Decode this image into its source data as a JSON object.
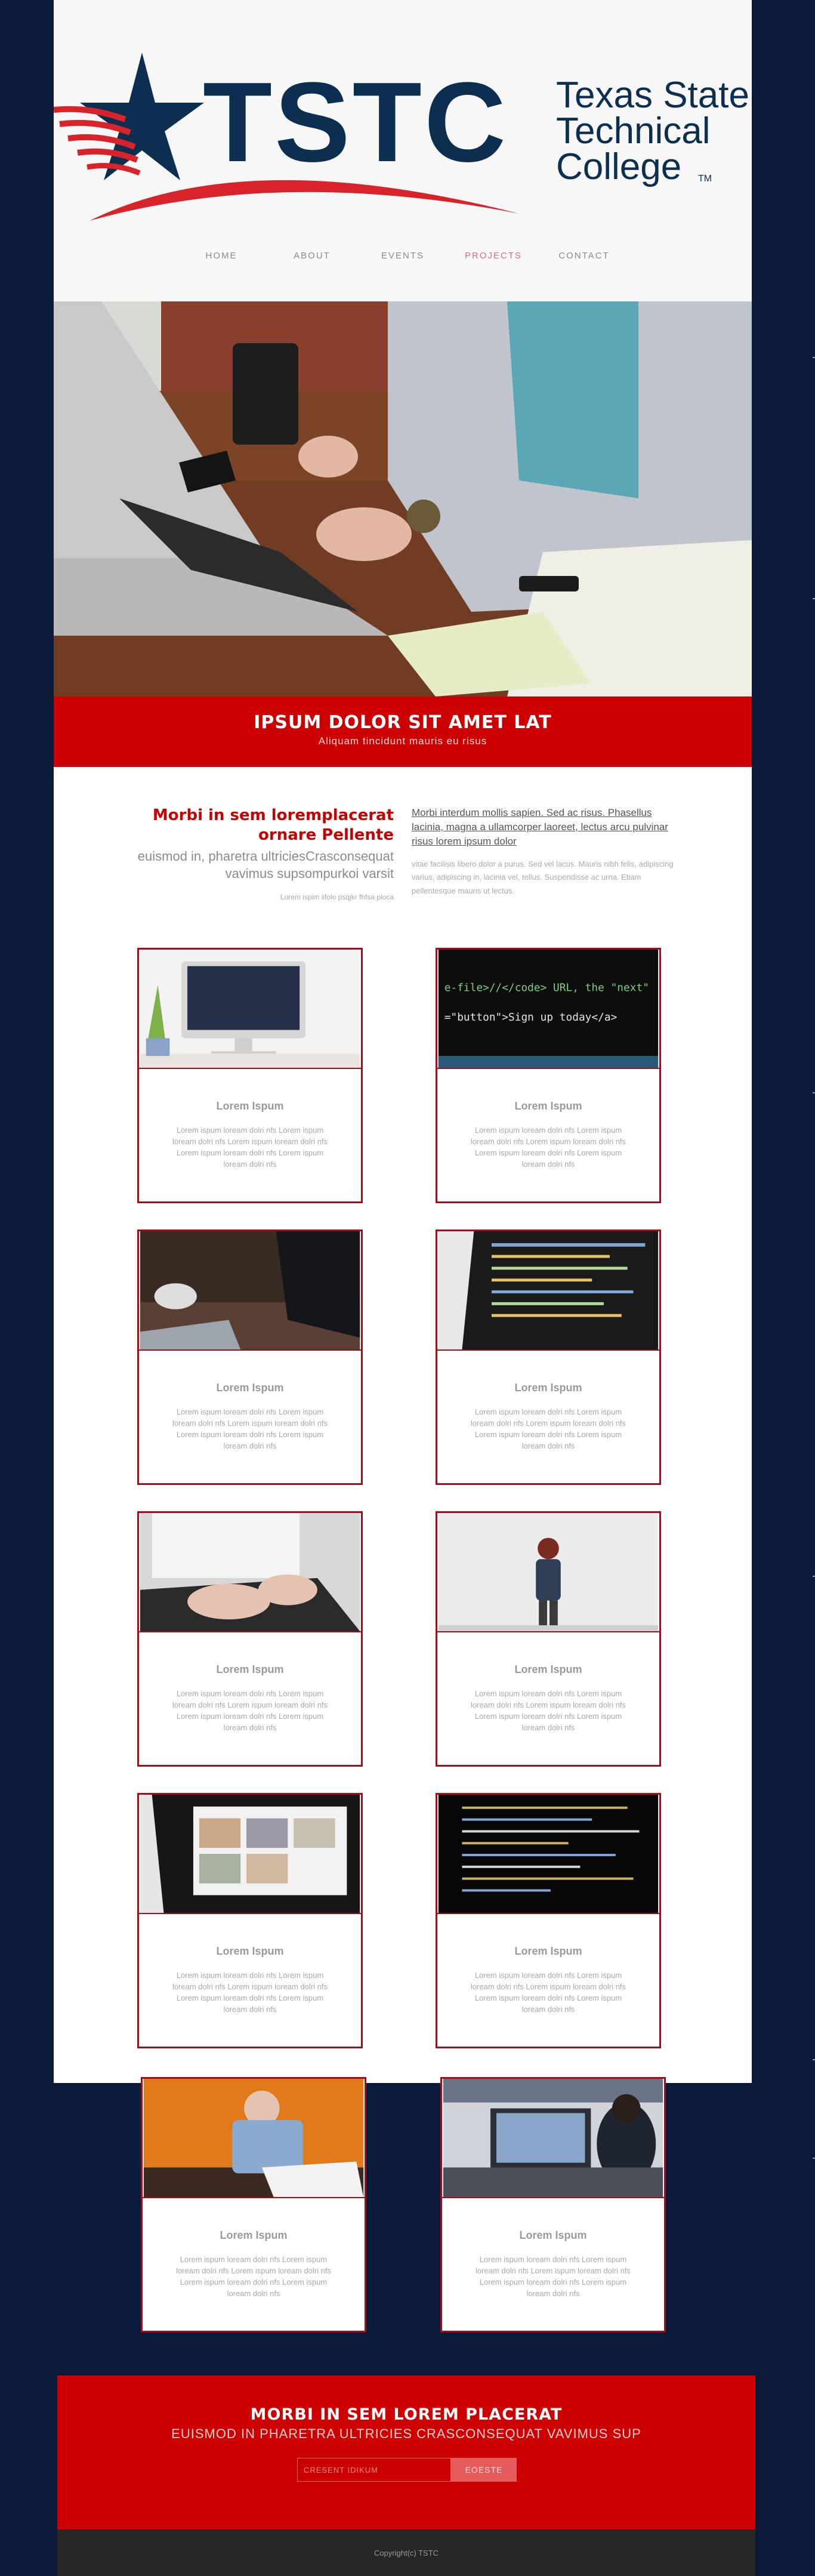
{
  "brand": {
    "abbr": "TSTC",
    "name_line1": "Texas State",
    "name_line2": "Technical",
    "name_line3": "College",
    "tm": "TM",
    "colors": {
      "navy": "#0c2f4f",
      "red": "#d8232a"
    }
  },
  "nav": {
    "items": [
      {
        "label": "HOME"
      },
      {
        "label": "ABOUT"
      },
      {
        "label": "EVENTS"
      },
      {
        "label": "PROJECTS",
        "active": true
      },
      {
        "label": "CONTACT"
      }
    ]
  },
  "banner": {
    "title": "IPSUM DOLOR SIT AMET LAT",
    "subtitle": "Aliquam tincidunt mauris eu risus"
  },
  "intro": {
    "heading": "Morbi in sem loremplacerat ornare Pellente",
    "subheading": "euismod in, pharetra ultriciesCrasconsequat vavimus supsompurkoi varsit",
    "small": "Lorem ispim lifolo psqjkr fhfsa ploca",
    "lead": "Morbi interdum mollis sapien. Sed ac risus. Phasellus lacinia, magna a ullamcorper laoreet, lectus arcu pulvinar risus lorem ipsum dolor",
    "body": "vitae facilisis libero dolor a purus. Sed vel lacus. Mauris nibh felis, adipiscing varius, adipiscing in, lacinia vel, tellus. Suspendisse ac urna. Etiam pellentesque mauris ut lectus."
  },
  "cards": [
    {
      "title": "Lorem Ispum",
      "text": "Lorem ispum loream dolri nfs Lorem ispum loream dolri nfs Lorem ispum loream dolri nfs Lorem ispum loream dolri nfs Lorem ispum loream dolri nfs"
    },
    {
      "title": "Lorem Ispum",
      "text": "Lorem ispum loream dolri nfs Lorem ispum loream dolri nfs Lorem ispum loream dolri nfs Lorem ispum loream dolri nfs Lorem ispum loream dolri nfs"
    },
    {
      "title": "Lorem Ispum",
      "text": "Lorem ispum loream dolri nfs Lorem ispum loream dolri nfs Lorem ispum loream dolri nfs Lorem ispum loream dolri nfs Lorem ispum loream dolri nfs"
    },
    {
      "title": "Lorem Ispum",
      "text": "Lorem ispum loream dolri nfs Lorem ispum loream dolri nfs Lorem ispum loream dolri nfs Lorem ispum loream dolri nfs Lorem ispum loream dolri nfs"
    },
    {
      "title": "Lorem Ispum",
      "text": "Lorem ispum loream dolri nfs Lorem ispum loream dolri nfs Lorem ispum loream dolri nfs Lorem ispum loream dolri nfs Lorem ispum loream dolri nfs"
    },
    {
      "title": "Lorem Ispum",
      "text": "Lorem ispum loream dolri nfs Lorem ispum loream dolri nfs Lorem ispum loream dolri nfs Lorem ispum loream dolri nfs Lorem ispum loream dolri nfs"
    },
    {
      "title": "Lorem Ispum",
      "text": "Lorem ispum loream dolri nfs Lorem ispum loream dolri nfs Lorem ispum loream dolri nfs Lorem ispum loream dolri nfs Lorem ispum loream dolri nfs"
    },
    {
      "title": "Lorem Ispum",
      "text": "Lorem ispum loream dolri nfs Lorem ispum loream dolri nfs Lorem ispum loream dolri nfs Lorem ispum loream dolri nfs Lorem ispum loream dolri nfs"
    },
    {
      "title": "Lorem Ispum",
      "text": "Lorem ispum loream dolri nfs Lorem ispum loream dolri nfs Lorem ispum loream dolri nfs Lorem ispum loream dolri nfs Lorem ispum loream dolri nfs"
    },
    {
      "title": "Lorem Ispum",
      "text": "Lorem ispum loream dolri nfs Lorem ispum loream dolri nfs Lorem ispum loream dolri nfs Lorem ispum loream dolri nfs Lorem ispum loream dolri nfs"
    }
  ],
  "newsletter": {
    "title": "MORBI IN SEM LOREM PLACERAT",
    "subtitle": "EUISMOD IN PHARETRA ULTRICIES CRASCONSEQUAT VAVIMUS SUP",
    "placeholder": "CRESENT IDIKUM",
    "button": "EOESTE"
  },
  "footer": {
    "copyright": "Copyright(c) TSTC"
  }
}
